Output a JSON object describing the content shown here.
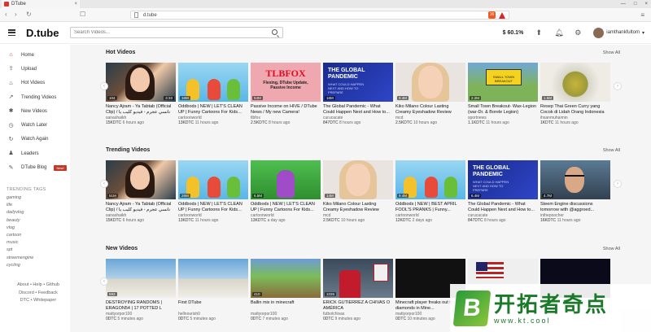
{
  "browser": {
    "tab_title": "DTube",
    "url": "d.tube",
    "shield_count": "16"
  },
  "header": {
    "logo": "D.tube",
    "search_placeholder": "Search Videos...",
    "price": "$ 60.1%",
    "username": "iamthankfultom"
  },
  "sidebar": {
    "items": [
      {
        "label": "Home",
        "icon": "home-icon",
        "glyph": "⌂"
      },
      {
        "label": "Upload",
        "icon": "upload-icon",
        "glyph": "⇪"
      },
      {
        "label": "Hot Videos",
        "icon": "flame-icon",
        "glyph": "♨"
      },
      {
        "label": "Trending Videos",
        "icon": "trending-icon",
        "glyph": "↗"
      },
      {
        "label": "New Videos",
        "icon": "star-icon",
        "glyph": "✱"
      },
      {
        "label": "Watch Later",
        "icon": "clock-icon",
        "glyph": "◷"
      },
      {
        "label": "Watch Again",
        "icon": "history-icon",
        "glyph": "↻"
      },
      {
        "label": "Leaders",
        "icon": "leaders-icon",
        "glyph": "♟"
      },
      {
        "label": "DTube Blog",
        "icon": "blog-icon",
        "glyph": "✎",
        "badge": "New!"
      }
    ],
    "tags_title": "TRENDING TAGS",
    "tags": [
      "gaming",
      "life",
      "dailyvlog",
      "beauty",
      "vlog",
      "cartoon",
      "music",
      "spt",
      "streemengine",
      "cycling"
    ],
    "footer_line1": "About • Help • Github",
    "footer_line2": "Discord • Feedback",
    "footer_line3": "DTC • Whitepaper"
  },
  "sections": {
    "hot": {
      "title": "Hot Videos",
      "show_all": "Show All",
      "videos": [
        {
          "title": "Nancy Ajram - Ya Tabtab (Official Clip) / نانسي عجرم - فيديو كليب يا طبطب",
          "author": "sanashaikh",
          "value": "15KDTC",
          "age": "6 hours ago",
          "badge": "104",
          "duration": "4:33",
          "thumb": "woman"
        },
        {
          "title": "Oddbods | NEW | LET'S CLEAN UP | Funny Cartoons For Kids...",
          "author": "cartoonworld",
          "value": "13KDTC",
          "age": "11 hours ago",
          "badge": "16M",
          "duration": "",
          "thumb": "cartoon"
        },
        {
          "title": "Passive Income on HIVE / DTube News / My new Camera!",
          "author": "tlbfox",
          "value": "2.5KDTC",
          "age": "8 hours ago",
          "badge": "54M",
          "duration": "",
          "thumb": "tlbfox"
        },
        {
          "title": "The Global Pandemic - What Could Happen Next and How to...",
          "author": "curucacate",
          "value": "847DTC",
          "age": "8 hours ago",
          "badge": "16M",
          "duration": "",
          "thumb": "pandemic"
        },
        {
          "title": "Kiko Milano Colour Lasting Creamy Eyeshadow Review",
          "author": "mcd",
          "value": "2.5KDTC",
          "age": "10 hours ago",
          "badge": "9.4M",
          "duration": "",
          "thumb": "blonde"
        },
        {
          "title": "Small Town Breakout- Wax-Legion (war-Dr. & Borele Legion)",
          "author": "sportnews",
          "value": "1.1KDTC",
          "age": "11 hours ago",
          "badge": "2.2M",
          "duration": "",
          "thumb": "sign"
        },
        {
          "title": "Resep Thai Green Curry yang Cocok di Lidah Orang Indonesia",
          "author": "ihsanmuhaimin",
          "value": "1KDTC",
          "age": "11 hours ago",
          "badge": "1.5M",
          "duration": "",
          "thumb": "curry"
        }
      ]
    },
    "trending": {
      "title": "Trending Videos",
      "show_all": "Show All",
      "videos": [
        {
          "title": "Nancy Ajram - Ya Tabtab (Official Clip) / نانسي عجرم - فيديو كليب يا طبطب",
          "author": "sanashaikh",
          "value": "15KDTC",
          "age": "6 hours ago",
          "badge": "51M",
          "duration": "",
          "thumb": "woman"
        },
        {
          "title": "Oddbods | NEW | LET'S CLEAN UP | Funny Cartoons For Kids...",
          "author": "cartoonworld",
          "value": "13KDTC",
          "age": "11 hours ago",
          "badge": "26M",
          "duration": "",
          "thumb": "cartoon"
        },
        {
          "title": "Oddbods | NEW | LET'S CLEAN UP | Funny Cartoons For Kids...",
          "author": "cartoonworld",
          "value": "13KDTC",
          "age": "a day ago",
          "badge": "6.5M",
          "duration": "",
          "thumb": "green"
        },
        {
          "title": "Kiko Milano Colour Lasting Creamy Eyeshadow Review",
          "author": "mcd",
          "value": "2.5KDTC",
          "age": "10 hours ago",
          "badge": "14M",
          "duration": "",
          "thumb": "blonde"
        },
        {
          "title": "Oddbods | NEW | BEST APRIL FOOL'S PRANKS | Funny...",
          "author": "cartoonworld",
          "value": "12KDTC",
          "age": "2 days ago",
          "badge": "9.4M",
          "duration": "",
          "thumb": "cartoon"
        },
        {
          "title": "The Global Pandemic - What Could Happen Next and How to...",
          "author": "curucacate",
          "value": "847DTC",
          "age": "8 hours ago",
          "badge": "6.4M",
          "duration": "",
          "thumb": "pandemic"
        },
        {
          "title": "Steem Engine discussions tomorrow with @aggroed...",
          "author": "inthepoocher",
          "value": "16KDTC",
          "age": "11 hours ago",
          "badge": "4.7M",
          "duration": "",
          "thumb": "man"
        }
      ]
    },
    "new": {
      "title": "New Videos",
      "show_all": "Show All",
      "videos": [
        {
          "title": "DESTROYING RANDOMS | ERAGON54 | 17 POTTED L",
          "author": "mattyorpor100",
          "value": "0DTC",
          "age": "5 minutes ago",
          "badge": "593",
          "duration": "",
          "thumb": "sky"
        },
        {
          "title": "First DTube",
          "author": "hellnourish0",
          "value": "0DTC",
          "age": "5 minutes ago",
          "badge": "",
          "duration": "",
          "thumb": "sky2"
        },
        {
          "title": "Ballin mix in minecraft",
          "author": "mattyorpor100",
          "value": "0DTC",
          "age": "7 minutes ago",
          "badge": "410",
          "duration": "",
          "thumb": "minecraft"
        },
        {
          "title": "ERICK GUTIERREZ A CHIVAS O AMÉRICA",
          "author": "futbolchivas",
          "value": "0DTC",
          "age": "9 minutes ago",
          "badge": "1026",
          "duration": "",
          "thumb": "soccer"
        },
        {
          "title": "Minecraft player freaks out finding diamonds in Mine...",
          "author": "mattyorpor100",
          "value": "0DTC",
          "age": "10 minutes ago",
          "badge": "",
          "duration": "",
          "thumb": "mineblack"
        },
        {
          "title": "",
          "author": "",
          "value": "",
          "age": "",
          "badge": "",
          "duration": "",
          "thumb": "american"
        },
        {
          "title": "",
          "author": "",
          "value": "",
          "age": "",
          "badge": "",
          "duration": "",
          "thumb": "darkblue"
        }
      ]
    }
  },
  "watermark": {
    "logo_letter": "B",
    "chinese": "开拓者奇点",
    "url": "www.kt.cool"
  },
  "colors": {
    "accent": "#c0392b",
    "pandemic_blue": "#1a2b8f",
    "watermark_green": "#1a7a2a"
  }
}
